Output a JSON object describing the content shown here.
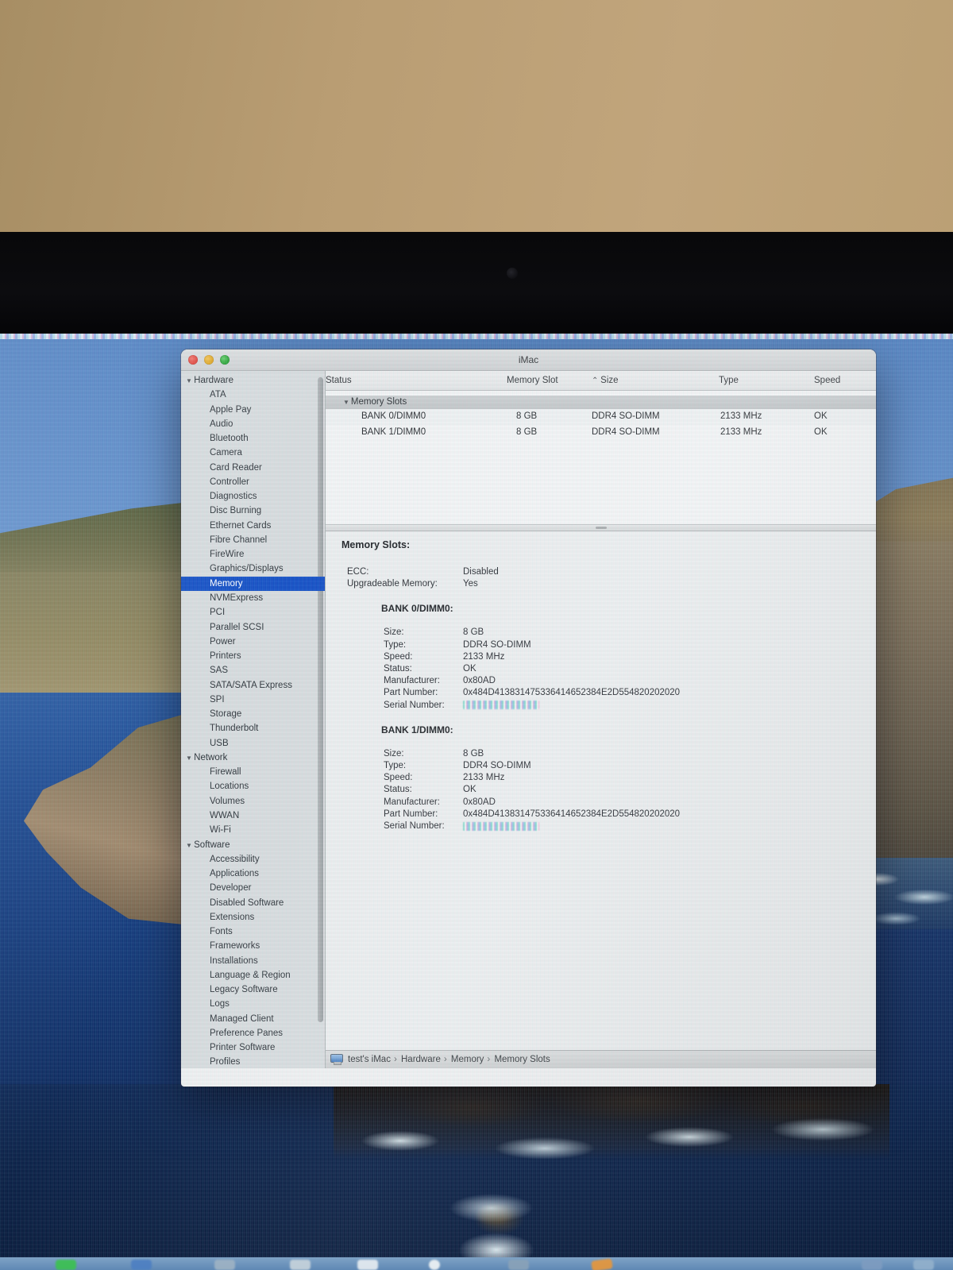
{
  "window": {
    "title": "iMac",
    "traffic_lights": {
      "close": "close-button",
      "minimize": "minimize-button",
      "zoom": "zoom-button"
    }
  },
  "icons": {
    "disclosure_open": "▼",
    "sort_ascending": "⌃",
    "breadcrumb_separator": "›",
    "computer": "mini-display-icon"
  },
  "sidebar": {
    "items": [
      {
        "label": "Hardware",
        "kind": "group"
      },
      {
        "label": "ATA"
      },
      {
        "label": "Apple Pay"
      },
      {
        "label": "Audio"
      },
      {
        "label": "Bluetooth"
      },
      {
        "label": "Camera"
      },
      {
        "label": "Card Reader"
      },
      {
        "label": "Controller"
      },
      {
        "label": "Diagnostics"
      },
      {
        "label": "Disc Burning"
      },
      {
        "label": "Ethernet Cards"
      },
      {
        "label": "Fibre Channel"
      },
      {
        "label": "FireWire"
      },
      {
        "label": "Graphics/Displays"
      },
      {
        "label": "Memory",
        "selected": true
      },
      {
        "label": "NVMExpress"
      },
      {
        "label": "PCI"
      },
      {
        "label": "Parallel SCSI"
      },
      {
        "label": "Power"
      },
      {
        "label": "Printers"
      },
      {
        "label": "SAS"
      },
      {
        "label": "SATA/SATA Express"
      },
      {
        "label": "SPI"
      },
      {
        "label": "Storage"
      },
      {
        "label": "Thunderbolt"
      },
      {
        "label": "USB"
      },
      {
        "label": "Network",
        "kind": "group"
      },
      {
        "label": "Firewall"
      },
      {
        "label": "Locations"
      },
      {
        "label": "Volumes"
      },
      {
        "label": "WWAN"
      },
      {
        "label": "Wi-Fi"
      },
      {
        "label": "Software",
        "kind": "group"
      },
      {
        "label": "Accessibility"
      },
      {
        "label": "Applications"
      },
      {
        "label": "Developer"
      },
      {
        "label": "Disabled Software"
      },
      {
        "label": "Extensions"
      },
      {
        "label": "Fonts"
      },
      {
        "label": "Frameworks"
      },
      {
        "label": "Installations"
      },
      {
        "label": "Language & Region"
      },
      {
        "label": "Legacy Software"
      },
      {
        "label": "Logs"
      },
      {
        "label": "Managed Client"
      },
      {
        "label": "Preference Panes"
      },
      {
        "label": "Printer Software"
      },
      {
        "label": "Profiles"
      }
    ]
  },
  "table": {
    "columns": [
      {
        "label": "Memory Slot"
      },
      {
        "label": "Size",
        "sorted": true
      },
      {
        "label": "Type"
      },
      {
        "label": "Speed"
      },
      {
        "label": "Status"
      }
    ],
    "group_row_label": "Memory Slots",
    "rows": [
      {
        "slot": "BANK 0/DIMM0",
        "size": "8 GB",
        "dimm_type": "DDR4 SO-DIMM",
        "speed": "2133 MHz",
        "status": "OK"
      },
      {
        "slot": "BANK 1/DIMM0",
        "size": "8 GB",
        "dimm_type": "DDR4 SO-DIMM",
        "speed": "2133 MHz",
        "status": "OK"
      }
    ]
  },
  "details": {
    "title": "Memory Slots:",
    "general": [
      {
        "label": "ECC:",
        "value": "Disabled"
      },
      {
        "label": "Upgradeable Memory:",
        "value": "Yes"
      }
    ],
    "bank0": {
      "title": "BANK 0/DIMM0:",
      "fields": [
        {
          "label": "Size:",
          "value": "8 GB"
        },
        {
          "label": "Type:",
          "value": "DDR4 SO-DIMM"
        },
        {
          "label": "Speed:",
          "value": "2133 MHz"
        },
        {
          "label": "Status:",
          "value": "OK"
        },
        {
          "label": "Manufacturer:",
          "value": "0x80AD"
        },
        {
          "label": "Part Number:",
          "value": "0x484D413831475336414652384E2D554820202020"
        },
        {
          "label": "Serial Number:",
          "value": "",
          "redacted": true
        }
      ]
    },
    "bank1": {
      "title": "BANK 1/DIMM0:",
      "fields": [
        {
          "label": "Size:",
          "value": "8 GB"
        },
        {
          "label": "Type:",
          "value": "DDR4 SO-DIMM"
        },
        {
          "label": "Speed:",
          "value": "2133 MHz"
        },
        {
          "label": "Status:",
          "value": "OK"
        },
        {
          "label": "Manufacturer:",
          "value": "0x80AD"
        },
        {
          "label": "Part Number:",
          "value": "0x484D413831475336414652384E2D554820202020"
        },
        {
          "label": "Serial Number:",
          "value": "",
          "redacted": true
        }
      ]
    }
  },
  "statusbar": {
    "breadcrumb": [
      "test's iMac",
      "Hardware",
      "Memory",
      "Memory Slots"
    ]
  },
  "colors": {
    "selection_blue": "#1853c6",
    "titlebar_gray": "#d4d7d9",
    "sidebar_gray": "#d7dcde",
    "detail_bg": "#ebeeef",
    "ocean_dark": "#0c2349",
    "sky_blue": "#6b97cf",
    "wall_tan": "#b99d73"
  }
}
